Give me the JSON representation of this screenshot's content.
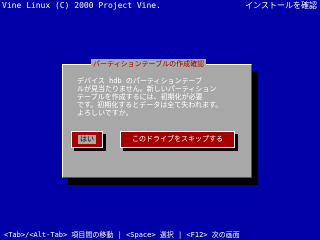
{
  "header": {
    "left_text": "Vine Linux (C) 2000 Project Vine.",
    "right_text": "インストールを確認"
  },
  "dialog": {
    "title": "パーティションテーブルの作成確認",
    "message": "デバイス hdb のパーティションテーブ\nルが見当たりません。新しいパーティション\nテーブルを作成するには、初期化が必要\nです。初期化するとデータは全て失われます。\nよろしいですか。",
    "buttons": {
      "yes_label": "はい",
      "no_label": "このドライブをスキップする"
    }
  },
  "footer": {
    "help_text": "<Tab>/<Alt-Tab> 項目間の移動 | <Space> 選択 | <F12> 次の画面"
  },
  "colors": {
    "background": "#0000a8",
    "dialog_bg": "#a8a8a8",
    "title_text": "#a80000",
    "button_bg": "#a80000",
    "button_text": "#ffffff"
  }
}
